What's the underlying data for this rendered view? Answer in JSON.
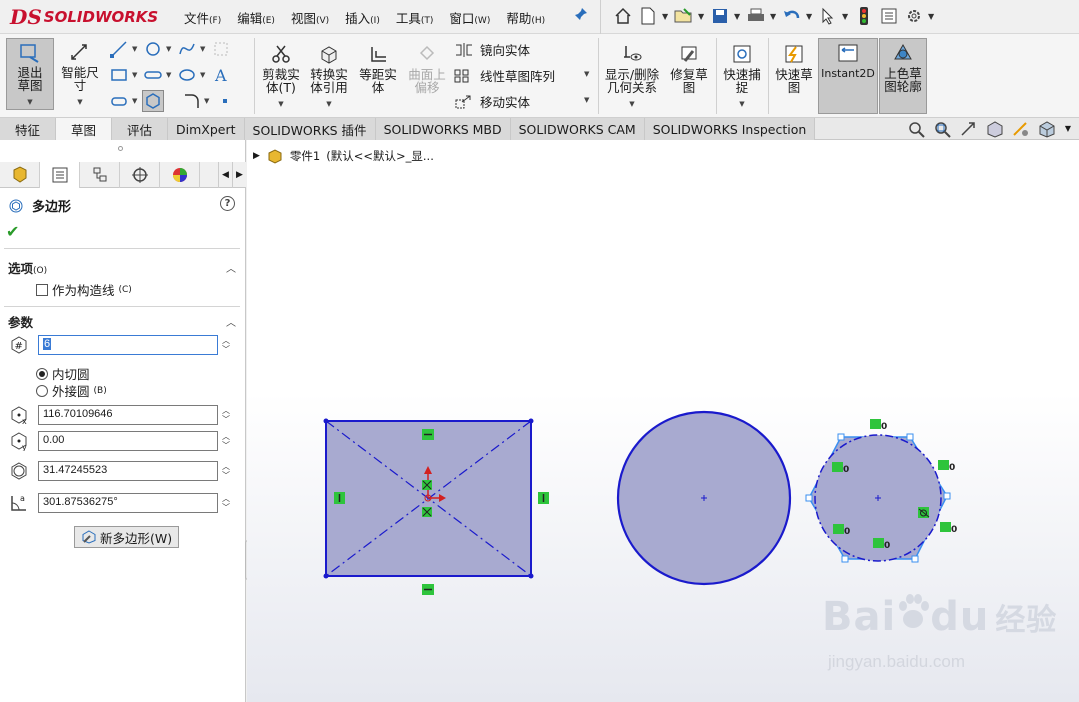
{
  "app": {
    "logo_prefix": "DS",
    "logo_text": "SOLIDWORKS"
  },
  "menu": [
    {
      "label": "文件",
      "key": "(F)"
    },
    {
      "label": "编辑",
      "key": "(E)"
    },
    {
      "label": "视图",
      "key": "(V)"
    },
    {
      "label": "插入",
      "key": "(I)"
    },
    {
      "label": "工具",
      "key": "(T)"
    },
    {
      "label": "窗口",
      "key": "(W)"
    },
    {
      "label": "帮助",
      "key": "(H)"
    }
  ],
  "ribbon": {
    "exit_sketch": "退出草图",
    "smart_dim": "智能尺寸",
    "trim": "剪裁实体(T)",
    "convert": "转换实体引用",
    "offset": "等距实体",
    "surface_offset": "曲面上偏移",
    "mirror": "镜向实体",
    "linear_pattern": "线性草图阵列",
    "move": "移动实体",
    "display_relations": "显示/删除几何关系",
    "repair": "修复草图",
    "quick_snap": "快速捕捉",
    "rapid_sketch": "快速草图",
    "instant2d": "Instant2D",
    "shaded_contours": "上色草图轮廓"
  },
  "tabs": [
    "特征",
    "草图",
    "评估",
    "DimXpert",
    "SOLIDWORKS 插件",
    "SOLIDWORKS MBD",
    "SOLIDWORKS CAM",
    "SOLIDWORKS Inspection"
  ],
  "tree": {
    "part": "零件1",
    "config": "(默认<<默认>_显..."
  },
  "property": {
    "title": "多边形",
    "options_header": "选项",
    "options_key": "(O)",
    "construction_label": "作为构造线",
    "construction_key": "(C)",
    "params_header": "参数",
    "sides_value": "6",
    "inscribed_label": "内切圆",
    "circumscribed_label": "外接圆",
    "circumscribed_key": "(B)",
    "center_x": "116.70109646",
    "center_y": "0.00",
    "diameter": "31.47245523",
    "angle": "301.87536275°",
    "new_polygon": "新多边形(W)"
  },
  "watermark": {
    "brand": "Bai",
    "brand2": "du",
    "cn": "经验",
    "url": "jingyan.baidu.com"
  },
  "colors": {
    "sketch_fill": "#a8aad0",
    "sketch_line": "#1a1acc",
    "relation_green": "#2ec43c",
    "accent_red": "#c8102e"
  }
}
